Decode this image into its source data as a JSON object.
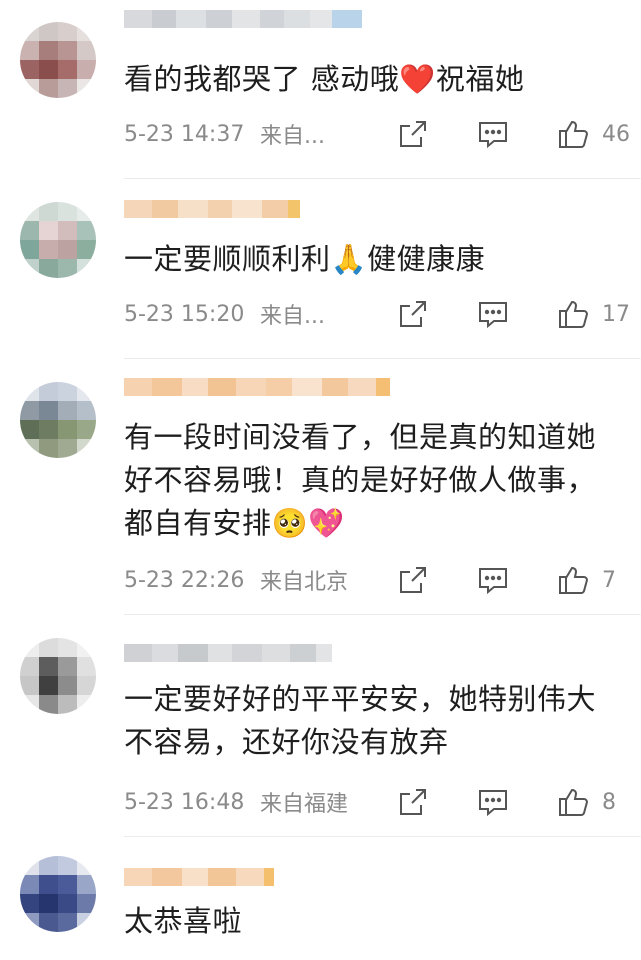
{
  "comments": [
    {
      "text": "看的我都哭了 感动哦❤️祝福她",
      "timestamp": "5-23 14:37",
      "source": "来自...",
      "likes": "46"
    },
    {
      "text": "一定要顺顺利利🙏健健康康",
      "timestamp": "5-23 15:20",
      "source": "来自...",
      "likes": "17"
    },
    {
      "text": "有一段时间没看了，但是真的知道她\n好不容易哦！真的是好好做人做事，\n都自有安排🥺💖",
      "timestamp": "5-23 22:26",
      "source": "来自北京",
      "likes": "7"
    },
    {
      "text": "一定要好好的平平安安，她特别伟大\n不容易，还好你没有放弃",
      "timestamp": "5-23 16:48",
      "source": "来自福建",
      "likes": "8"
    },
    {
      "text": "太恭喜啦"
    }
  ],
  "icons": {
    "share": "share-icon",
    "reply": "comment-icon",
    "like": "thumbs-up-icon"
  },
  "colors": {
    "meta_text": "#8a8a8a",
    "body_text": "#1e1e1e",
    "divider": "#ececec"
  }
}
